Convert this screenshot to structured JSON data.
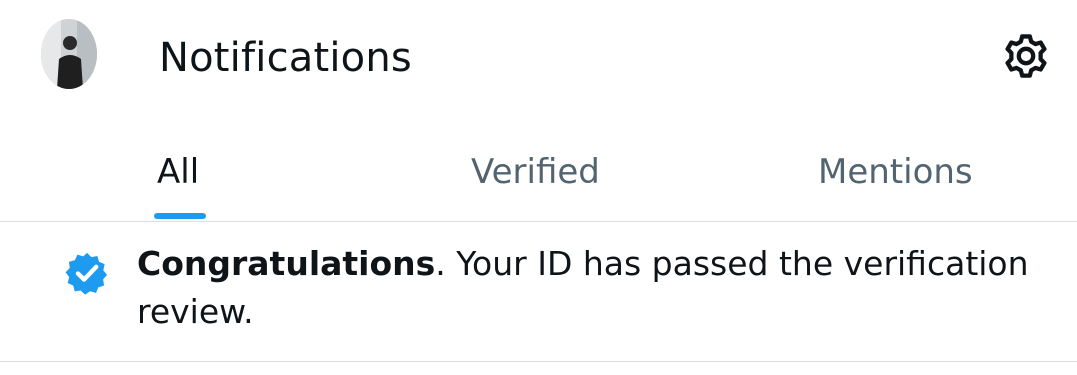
{
  "header": {
    "title": "Notifications",
    "avatar_icon": "user-avatar-photo",
    "settings_icon": "gear-icon"
  },
  "tabs": [
    {
      "label": "All",
      "active": true
    },
    {
      "label": "Verified",
      "active": false
    },
    {
      "label": "Mentions",
      "active": false
    }
  ],
  "notification": {
    "icon": "verified-badge-icon",
    "highlight": "Congratulations",
    "message": ". Your ID has passed the verification review."
  },
  "colors": {
    "accent": "#1d9bf0",
    "text_primary": "#0f1419",
    "text_secondary": "#536471",
    "divider": "#dcdfe2"
  }
}
